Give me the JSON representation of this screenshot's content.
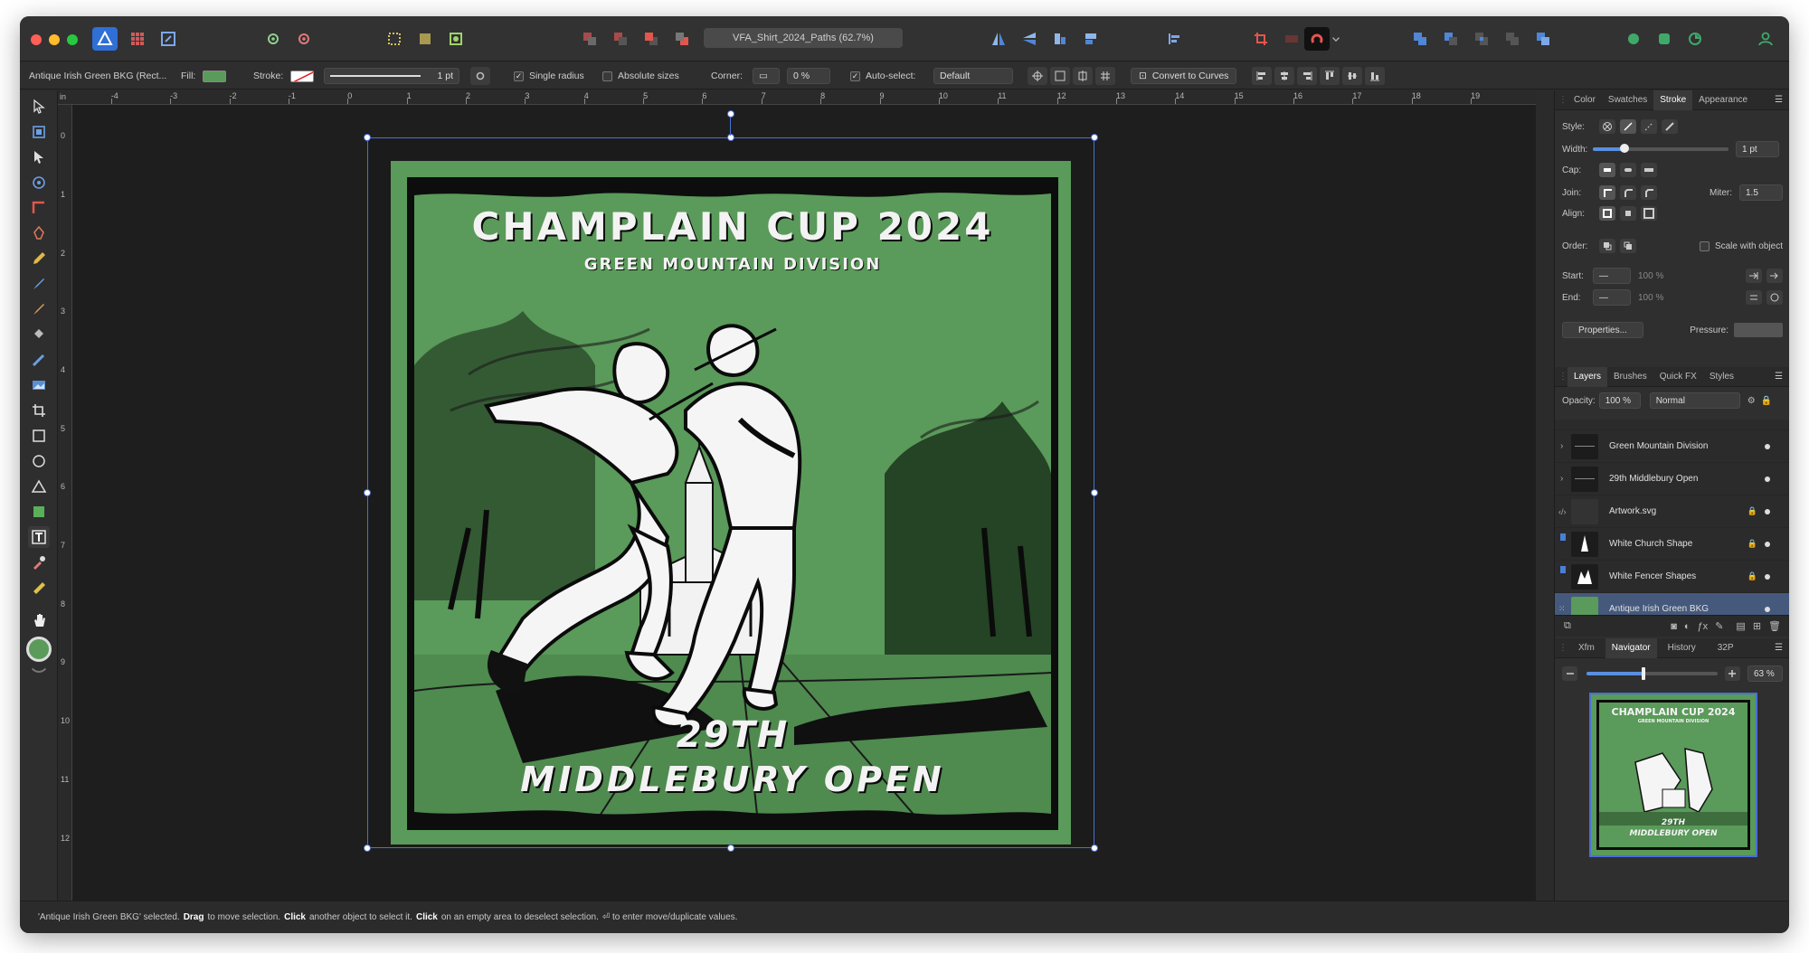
{
  "window": {
    "traffic_lights": [
      "#ff5f57",
      "#febc2e",
      "#28c840"
    ]
  },
  "toolbar": {
    "doc_title": "VFA_Shirt_2024_Paths (62.7%)",
    "icons": [
      "affinity-designer-icon",
      "persona-grid-icon",
      "persona-export-icon",
      "settings-gear-icon",
      "snapping-gear-icon",
      "select-frame-icon",
      "insert-inside-icon",
      "boolean-icon",
      "arrange-back-icon",
      "arrange-front-icon",
      "flip-horizontal-icon",
      "flip-vertical-icon",
      "align-icon",
      "distribute-icon",
      "align-left-icon",
      "crop-icon",
      "fill-swatch-icon",
      "snapping-magnet-icon",
      "boolean-add-icon",
      "boolean-subtract-icon",
      "boolean-intersect-icon",
      "boolean-xor-icon",
      "view-mode-icon",
      "assistant-icon",
      "user-account-icon"
    ]
  },
  "context": {
    "selected_name": "Antique Irish Green BKG (Rect...",
    "fill_label": "Fill:",
    "fill_color": "#5a9a5a",
    "stroke_label": "Stroke:",
    "stroke_width": "1 pt",
    "single_radius": "Single radius",
    "absolute_sizes": "Absolute sizes",
    "corner_label": "Corner:",
    "corner_value": "0 %",
    "auto_select_label": "Auto-select:",
    "auto_select_value": "Default",
    "convert_to_curves": "Convert to Curves"
  },
  "rulers": {
    "h": [
      "-4",
      "-3",
      "-2",
      "-1",
      "0",
      "1",
      "2",
      "3",
      "4",
      "5",
      "6",
      "7",
      "8",
      "9",
      "10",
      "11",
      "12",
      "13",
      "14",
      "15",
      "16",
      "17",
      "18",
      "19"
    ],
    "v": [
      "0",
      "1",
      "2",
      "3",
      "4",
      "5",
      "6",
      "7",
      "8",
      "9",
      "10",
      "11",
      "12"
    ],
    "unit": "in"
  },
  "artwork": {
    "title": "CHAMPLAIN CUP 2024",
    "subtitle": "GREEN MOUNTAIN DIVISION",
    "line1": "29TH",
    "line2": "MIDDLEBURY OPEN",
    "bg_color": "#5a9a5a"
  },
  "panel": {
    "top_tabs": [
      "Color",
      "Swatches",
      "Stroke",
      "Appearance"
    ],
    "active_top_tab": "Stroke",
    "style_label": "Style:",
    "width_label": "Width:",
    "width_value": "1 pt",
    "cap_label": "Cap:",
    "join_label": "Join:",
    "miter_label": "Miter:",
    "miter_value": "1.5",
    "align_label": "Align:",
    "order_label": "Order:",
    "scale_with_object": "Scale with object",
    "start_label": "Start:",
    "start_pct": "100 %",
    "end_label": "End:",
    "end_pct": "100 %",
    "properties_btn": "Properties...",
    "pressure_label": "Pressure:"
  },
  "layers_panel": {
    "tabs": [
      "Layers",
      "Brushes",
      "Quick FX",
      "Styles"
    ],
    "active_tab": "Layers",
    "opacity_label": "Opacity:",
    "opacity_value": "100 %",
    "blend_mode": "Normal",
    "items": [
      {
        "name": "Green Mountain Division",
        "locked": false,
        "selected": false
      },
      {
        "name": "29th Middlebury Open",
        "locked": false,
        "selected": false
      },
      {
        "name": "Artwork.svg",
        "locked": true,
        "selected": false
      },
      {
        "name": "White Church Shape",
        "locked": true,
        "selected": false
      },
      {
        "name": "White Fencer Shapes",
        "locked": true,
        "selected": false
      },
      {
        "name": "Antique Irish Green BKG",
        "locked": false,
        "selected": true
      }
    ]
  },
  "nav_panel": {
    "tabs": [
      "Xfm",
      "Navigator",
      "History",
      "32P"
    ],
    "active_tab": "Navigator",
    "zoom_value": "63 %",
    "zoom_fraction": 0.42
  },
  "status": {
    "p1": "'Antique Irish Green BKG' selected.",
    "drag": "Drag",
    "p2": "to move selection.",
    "click1": "Click",
    "p3": "another object to select it.",
    "click2": "Click",
    "p4": "on an empty area to deselect selection.",
    "p5": "⏎ to enter move/duplicate values."
  }
}
